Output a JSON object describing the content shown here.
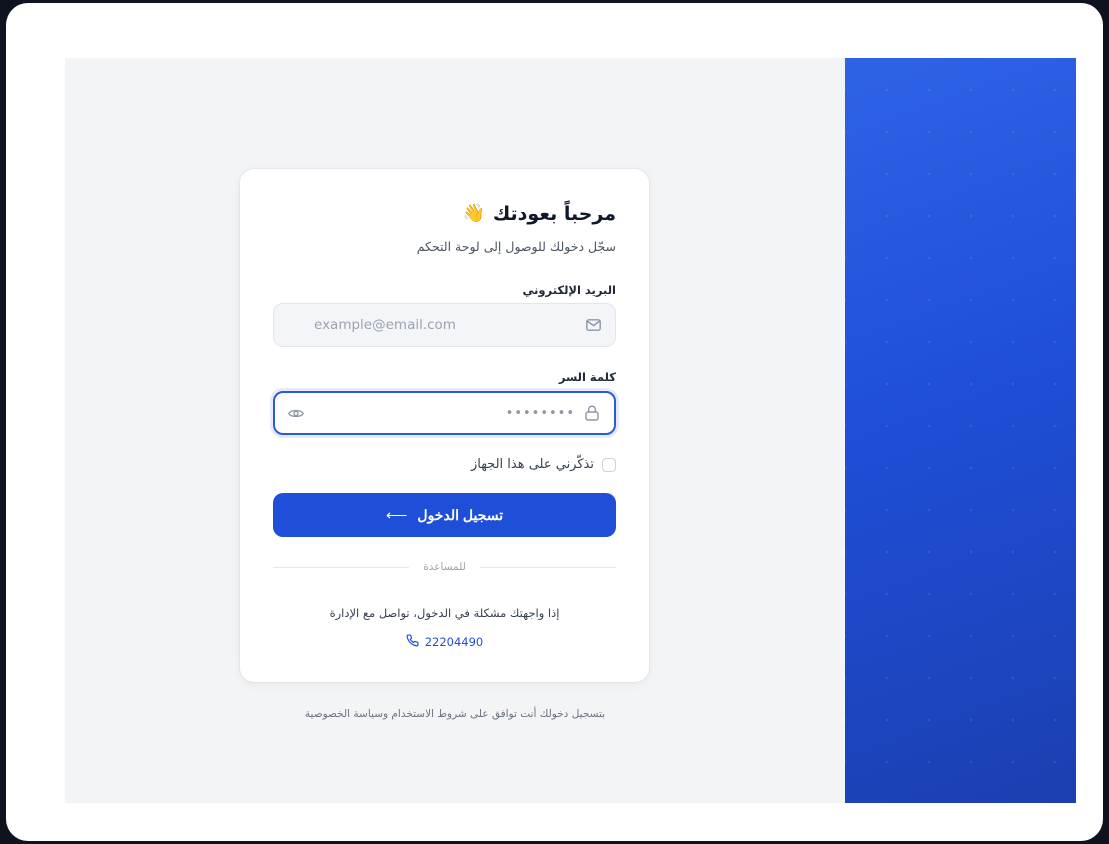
{
  "card": {
    "title": "مرحباً بعودتك",
    "wave_emoji": "👋",
    "subtitle": "سجّل دخولك للوصول إلى لوحة التحكم",
    "email_label": "البريد الإلكتروني",
    "email_placeholder": "example@email.com",
    "password_label": "كلمة السر",
    "password_value": "••••••••",
    "remember_label": "تذكّرني على هذا الجهاز",
    "login_button": "تسجيل الدخول",
    "divider_label": "للمساعدة",
    "help_text": "إذا واجهتك مشكلة في الدخول، تواصل مع الإدارة",
    "phone": "22204490"
  },
  "footer": {
    "terms": "بتسجيل دخولك أنت توافق على شروط الاستخدام وسياسة الخصوصية"
  },
  "colors": {
    "accent": "#1f4fd8",
    "panel_gradient_start": "#2f63e6",
    "panel_gradient_end": "#1b3fb0"
  },
  "icons": {
    "email": "mail-icon",
    "password": "lock-icon",
    "toggle": "eye-icon",
    "phone": "phone-icon",
    "button": "arrow-left-icon"
  }
}
